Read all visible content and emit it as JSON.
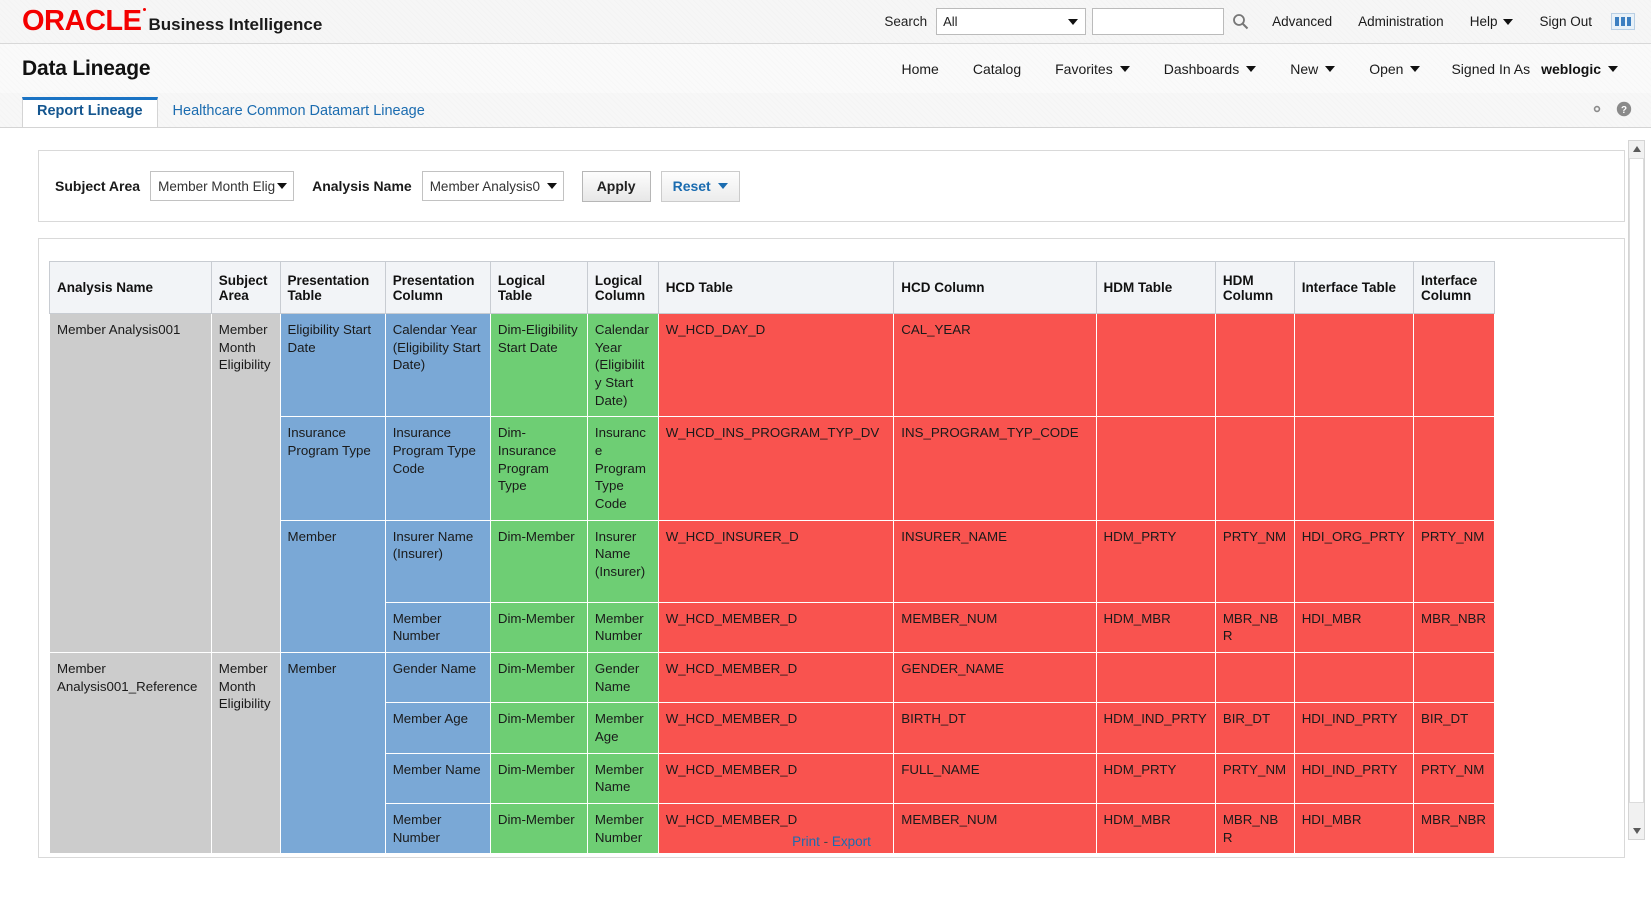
{
  "global_header": {
    "brand_oracle": "ORACLE",
    "brand_product": "Business Intelligence",
    "brand_color": "#f40000",
    "search_label": "Search",
    "search_scope_value": "All",
    "search_input_value": "",
    "search_input_placeholder": "",
    "links": [
      {
        "label": "Advanced",
        "has_caret": false
      },
      {
        "label": "Administration",
        "has_caret": false
      },
      {
        "label": "Help",
        "has_caret": true
      },
      {
        "label": "Sign Out",
        "has_caret": false
      }
    ]
  },
  "page_bar": {
    "title": "Data Lineage",
    "nav": [
      {
        "label": "Home",
        "has_caret": false
      },
      {
        "label": "Catalog",
        "has_caret": false
      },
      {
        "label": "Favorites",
        "has_caret": true
      },
      {
        "label": "Dashboards",
        "has_caret": true
      },
      {
        "label": "New",
        "has_caret": true
      },
      {
        "label": "Open",
        "has_caret": true
      }
    ],
    "signed_in_as_label": "Signed In As",
    "signed_in_user": "weblogic"
  },
  "tabs": [
    {
      "label": "Report Lineage",
      "active": true
    },
    {
      "label": "Healthcare Common Datamart Lineage",
      "active": false
    }
  ],
  "filters": {
    "subject_area_label": "Subject Area",
    "subject_area_value": "Member Month Elig",
    "analysis_name_label": "Analysis Name",
    "analysis_name_value": "Member Analysis0",
    "apply_label": "Apply",
    "reset_label": "Reset"
  },
  "table": {
    "columns": [
      "Analysis Name",
      "Subject Area",
      "Presentation Table",
      "Presentation Column",
      "Logical Table",
      "Logical Column",
      "HCD Table",
      "HCD Column",
      "HDM Table",
      "HDM Column",
      "Interface Table",
      "Interface Column"
    ],
    "rows": [
      {
        "analysis_name": "Member Analysis001",
        "analysis_rowspan": 4,
        "subject_area": "Member Month Eligibility",
        "subject_rowspan": 4,
        "presentation_table": "Eligibility Start Date",
        "pt_rowspan": 1,
        "presentation_column": "Calendar Year (Eligibility Start Date)",
        "logical_table": "Dim-Eligibility Start Date",
        "logical_column": "Calendar Year (Eligibility Start Date)",
        "hcd_table": "W_HCD_DAY_D",
        "hcd_column": "CAL_YEAR",
        "hdm_table": "",
        "hdm_column": "",
        "interface_table": "",
        "interface_column": ""
      },
      {
        "presentation_table": "Insurance Program Type",
        "pt_rowspan": 1,
        "presentation_column": "Insurance Program Type Code",
        "logical_table": "Dim-Insurance Program Type",
        "logical_column": "Insurance Program Type Code",
        "hcd_table": "W_HCD_INS_PROGRAM_TYP_DV",
        "hcd_column": "INS_PROGRAM_TYP_CODE",
        "hdm_table": "",
        "hdm_column": "",
        "interface_table": "",
        "interface_column": ""
      },
      {
        "presentation_table": "Member",
        "pt_rowspan": 2,
        "presentation_column": "Insurer Name (Insurer)",
        "logical_table": "Dim-Member",
        "logical_column": "Insurer Name (Insurer)",
        "hcd_table": "W_HCD_INSURER_D",
        "hcd_column": "INSURER_NAME",
        "hdm_table": "HDM_PRTY",
        "hdm_column": "PRTY_NM",
        "interface_table": "HDI_ORG_PRTY",
        "interface_column": "PRTY_NM"
      },
      {
        "presentation_column": "Member Number",
        "logical_table": "Dim-Member",
        "logical_column": "Member Number",
        "hcd_table": "W_HCD_MEMBER_D",
        "hcd_column": "MEMBER_NUM",
        "hdm_table": "HDM_MBR",
        "hdm_column": "MBR_NBR",
        "interface_table": "HDI_MBR",
        "interface_column": "MBR_NBR"
      },
      {
        "analysis_name": "Member Analysis001_Reference",
        "analysis_rowspan": 4,
        "subject_area": "Member Month Eligibility",
        "subject_rowspan": 4,
        "presentation_table": "Member",
        "pt_rowspan": 4,
        "presentation_column": "Gender Name",
        "logical_table": "Dim-Member",
        "logical_column": "Gender Name",
        "hcd_table": "W_HCD_MEMBER_D",
        "hcd_column": "GENDER_NAME",
        "hdm_table": "",
        "hdm_column": "",
        "interface_table": "",
        "interface_column": ""
      },
      {
        "presentation_column": "Member Age",
        "logical_table": "Dim-Member",
        "logical_column": "Member Age",
        "hcd_table": "W_HCD_MEMBER_D",
        "hcd_column": "BIRTH_DT",
        "hdm_table": "HDM_IND_PRTY",
        "hdm_column": "BIR_DT",
        "interface_table": "HDI_IND_PRTY",
        "interface_column": "BIR_DT"
      },
      {
        "presentation_column": "Member Name",
        "logical_table": "Dim-Member",
        "logical_column": "Member Name",
        "hcd_table": "W_HCD_MEMBER_D",
        "hcd_column": "FULL_NAME",
        "hdm_table": "HDM_PRTY",
        "hdm_column": "PRTY_NM",
        "interface_table": "HDI_IND_PRTY",
        "interface_column": "PRTY_NM"
      },
      {
        "presentation_column": "Member Number",
        "logical_table": "Dim-Member",
        "logical_column": "Member Number",
        "hcd_table": "W_HCD_MEMBER_D",
        "hcd_column": "MEMBER_NUM",
        "hdm_table": "HDM_MBR",
        "hdm_column": "MBR_NBR",
        "interface_table": "HDI_MBR",
        "interface_column": "MBR_NBR"
      }
    ]
  },
  "footer": {
    "print_label": "Print",
    "separator": "-",
    "export_label": "Export"
  },
  "colors": {
    "grey_cell": "#cccccc",
    "blue_cell": "#7aa8d6",
    "green_cell": "#6ece74",
    "red_cell": "#f9534f",
    "link_blue": "#1b6cb0",
    "tab_active_underline": "#1a73c4"
  }
}
